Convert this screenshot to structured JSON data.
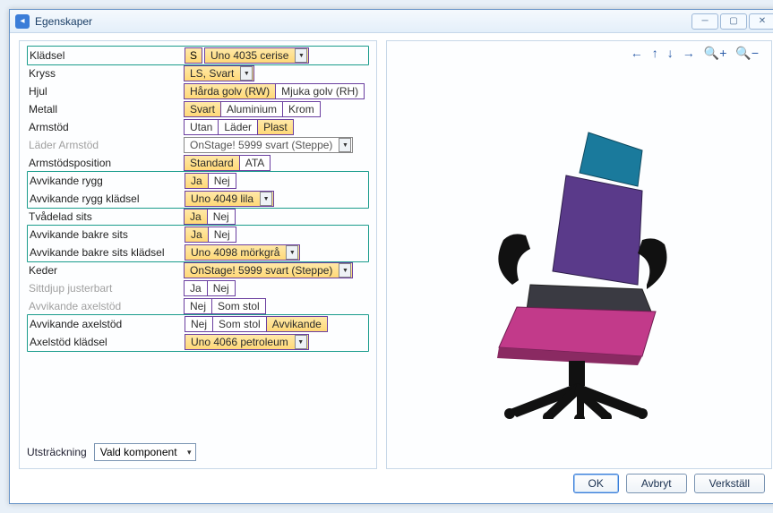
{
  "window": {
    "title": "Egenskaper"
  },
  "rows": {
    "kladsel": {
      "label": "Klädsel",
      "segPrefix": "S",
      "value": "Uno 4035 cerise"
    },
    "kryss": {
      "label": "Kryss",
      "value": "LS, Svart"
    },
    "hjul": {
      "label": "Hjul",
      "opt1": "Hårda golv (RW)",
      "opt2": "Mjuka golv (RH)"
    },
    "metall": {
      "label": "Metall",
      "opt1": "Svart",
      "opt2": "Aluminium",
      "opt3": "Krom"
    },
    "armstod": {
      "label": "Armstöd",
      "opt1": "Utan",
      "opt2": "Läder",
      "opt3": "Plast"
    },
    "laderArm": {
      "label": "Läder Armstöd",
      "value": "OnStage! 5999 svart (Steppe)"
    },
    "armPos": {
      "label": "Armstödsposition",
      "opt1": "Standard",
      "opt2": "ATA"
    },
    "avvRygg": {
      "label": "Avvikande rygg",
      "yes": "Ja",
      "no": "Nej"
    },
    "avvRyggKl": {
      "label": "Avvikande rygg klädsel",
      "value": "Uno 4049 lila"
    },
    "tvadelad": {
      "label": "Tvådelad sits",
      "yes": "Ja",
      "no": "Nej"
    },
    "avvBakre": {
      "label": "Avvikande bakre sits",
      "yes": "Ja",
      "no": "Nej"
    },
    "avvBakreKl": {
      "label": "Avvikande bakre sits klädsel",
      "value": "Uno 4098 mörkgrå"
    },
    "keder": {
      "label": "Keder",
      "value": "OnStage! 5999 svart (Steppe)"
    },
    "sittdjup": {
      "label": "Sittdjup justerbart",
      "yes": "Ja",
      "no": "Nej"
    },
    "avvAxel1": {
      "label": "Avvikande axelstöd",
      "opt1": "Nej",
      "opt2": "Som stol"
    },
    "avvAxel2": {
      "label": "Avvikande axelstöd",
      "opt1": "Nej",
      "opt2": "Som stol",
      "opt3": "Avvikande"
    },
    "axelKl": {
      "label": "Axelstöd klädsel",
      "value": "Uno 4066 petroleum"
    }
  },
  "extent": {
    "label": "Utsträckning",
    "value": "Vald komponent"
  },
  "buttons": {
    "ok": "OK",
    "cancel": "Avbryt",
    "apply": "Verkställ"
  }
}
